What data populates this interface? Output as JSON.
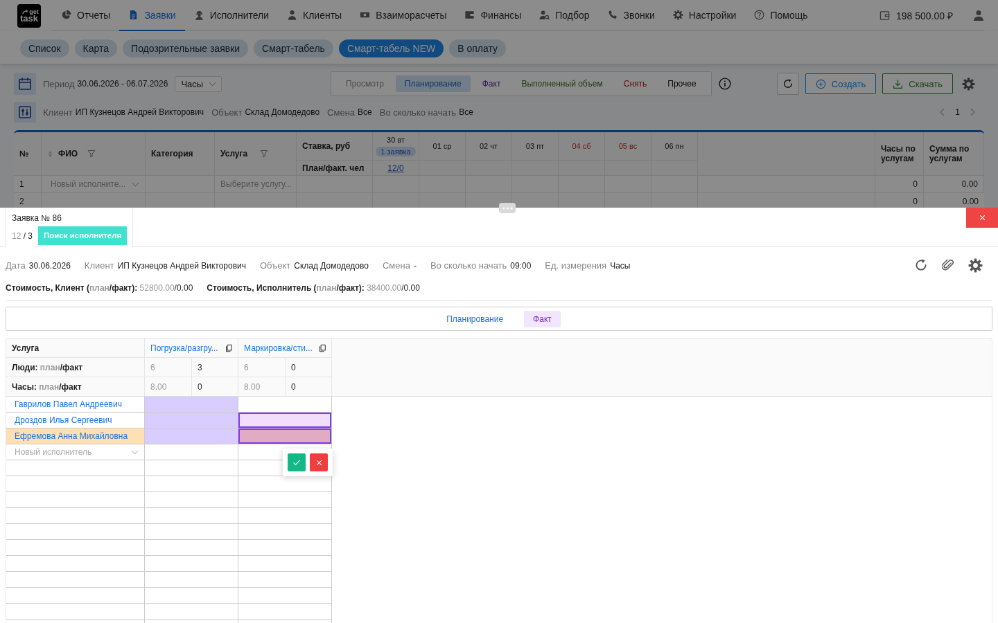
{
  "top_nav": {
    "logo": {
      "line_1": "get",
      "line_2": "task"
    },
    "items": [
      {
        "label": "Отчеты",
        "selected": false
      },
      {
        "label": "Заявки",
        "selected": true
      },
      {
        "label": "Исполнители",
        "selected": false
      },
      {
        "label": "Клиенты",
        "selected": false
      },
      {
        "label": "Взаиморасчеты",
        "selected": false
      },
      {
        "label": "Финансы",
        "selected": false
      },
      {
        "label": "Подбор",
        "selected": false
      },
      {
        "label": "Звонки",
        "selected": false
      },
      {
        "label": "Настройки",
        "selected": false
      },
      {
        "label": "Помощь",
        "selected": false
      }
    ],
    "balance": "198 500.00 ₽"
  },
  "sub_tabs": [
    {
      "label": "Список",
      "selected": false
    },
    {
      "label": "Карта",
      "selected": false
    },
    {
      "label": "Подозрительные заявки",
      "selected": false
    },
    {
      "label": "Смарт-табель",
      "selected": false
    },
    {
      "label": "Смарт-табель NEW",
      "selected": true
    },
    {
      "label": "В оплату",
      "selected": false
    }
  ],
  "toolbar": {
    "period_label": "Период",
    "period": "30.06.2026 - 06.07.2026",
    "unit": "Часы",
    "modes": [
      {
        "label": "Просмотр",
        "selected": false,
        "kind": "view"
      },
      {
        "label": "Планирование",
        "selected": true,
        "kind": "plan"
      },
      {
        "label": "Факт",
        "selected": false,
        "kind": "fact"
      },
      {
        "label": "Выполненный объем",
        "selected": false,
        "kind": "volume"
      },
      {
        "label": "Снять",
        "selected": false,
        "kind": "remove"
      },
      {
        "label": "Прочее",
        "selected": false,
        "kind": "other"
      }
    ],
    "create_button": "Создать",
    "download_button": "Скачать",
    "filters": [
      {
        "label": "Клиент",
        "value": "ИП Кузнецов Андрей Викторович"
      },
      {
        "label": "Объект",
        "value": "Склад Домодедово"
      },
      {
        "label": "Смена",
        "value": "Все"
      },
      {
        "label": "Во сколько начать",
        "value": "Все"
      }
    ],
    "page": "1"
  },
  "schedule_table": {
    "columns": {
      "number": "№",
      "name": "ФИО",
      "category": "Категория",
      "service": "Услуга",
      "rate": "Ставка, руб",
      "plan_fact": "План/факт. чел",
      "hours": "Часы по услугам",
      "total": "Сумма по услугам"
    },
    "days": [
      {
        "label": "30 вт",
        "weekend": false,
        "badge": "1 заявка",
        "plan_fact": "12/0"
      },
      {
        "label": "01 ср",
        "weekend": false
      },
      {
        "label": "02 чт",
        "weekend": false
      },
      {
        "label": "03 пт",
        "weekend": false
      },
      {
        "label": "04 сб",
        "weekend": true
      },
      {
        "label": "05 вс",
        "weekend": true
      },
      {
        "label": "06 пн",
        "weekend": false
      }
    ],
    "rows": [
      {
        "number": "1",
        "name_placeholder": "Новый исполните...",
        "service_placeholder": "Выберите услугу...",
        "hours": "0",
        "total": "0.00"
      },
      {
        "number": "2",
        "hours": "0",
        "total": "0.00"
      }
    ]
  },
  "order_panel": {
    "tab": {
      "title": "Заявка № 86",
      "counter": [
        {
          "text": "12",
          "muted": true
        },
        {
          "text": " / 3",
          "muted": false
        }
      ],
      "status": "Поиск исполнителя"
    },
    "details": [
      {
        "label": "Дата",
        "value": "30.06.2026"
      },
      {
        "label": "Клиент",
        "value": "ИП Кузнецов Андрей Викторович"
      },
      {
        "label": "Объект",
        "value": "Склад Домодедово"
      },
      {
        "label": "Смена",
        "value": "-"
      },
      {
        "label": "Во сколько начать",
        "value": "09:00"
      },
      {
        "label": "Ед. измерения",
        "value": "Часы"
      }
    ],
    "costs": [
      {
        "label": [
          {
            "text": "Стоимость, Клиент (",
            "muted": false
          },
          {
            "text": "план",
            "muted": true
          },
          {
            "text": "/факт): ",
            "muted": false
          }
        ],
        "value": [
          {
            "text": "52800.00",
            "muted": true
          },
          {
            "text": "/0.00",
            "muted": false
          }
        ]
      },
      {
        "label": [
          {
            "text": "Стоимость, Исполнитель (",
            "muted": false
          },
          {
            "text": "план",
            "muted": true
          },
          {
            "text": "/факт): ",
            "muted": false
          }
        ],
        "value": [
          {
            "text": "38400.00",
            "muted": true
          },
          {
            "text": "/0.00",
            "muted": false
          }
        ]
      }
    ],
    "modes": [
      {
        "label": "Планирование",
        "selected": false,
        "kind": "plan"
      },
      {
        "label": "Факт",
        "selected": true,
        "kind": "fact"
      }
    ],
    "grid": {
      "corner": "Услуга",
      "metrics": [
        {
          "label": [
            {
              "text": "Люди: ",
              "muted": false
            },
            {
              "text": "план",
              "muted": true
            },
            {
              "text": "/факт",
              "muted": false
            }
          ]
        },
        {
          "label": [
            {
              "text": "Часы: ",
              "muted": false
            },
            {
              "text": "план",
              "muted": true
            },
            {
              "text": "/факт",
              "muted": false
            }
          ]
        }
      ],
      "services": [
        {
          "name": "Погрузка/разгру...",
          "values": [
            {
              "plan": "6",
              "fact": "3"
            },
            {
              "plan": "8.00",
              "fact": "0"
            }
          ]
        },
        {
          "name": "Маркировка/сти...",
          "values": [
            {
              "plan": "6",
              "fact": "0"
            },
            {
              "plan": "8.00",
              "fact": "0"
            }
          ]
        }
      ],
      "workers": [
        {
          "name": "Гаврилов Павел Андреевич",
          "highlighted": false,
          "cells": [
            {
              "assigned": true,
              "selected": false
            },
            {
              "assigned": false,
              "selected": false
            }
          ]
        },
        {
          "name": "Дроздов Илья Сергеевич",
          "highlighted": false,
          "cells": [
            {
              "assigned": true,
              "selected": false
            },
            {
              "assigned": false,
              "selected": true
            }
          ]
        },
        {
          "name": "Ефремова Анна Михайловна",
          "highlighted": true,
          "cells": [
            {
              "assigned": true,
              "selected": false
            },
            {
              "assigned": true,
              "selected": true
            }
          ]
        }
      ],
      "new_worker_placeholder": "Новый исполнитель"
    }
  }
}
